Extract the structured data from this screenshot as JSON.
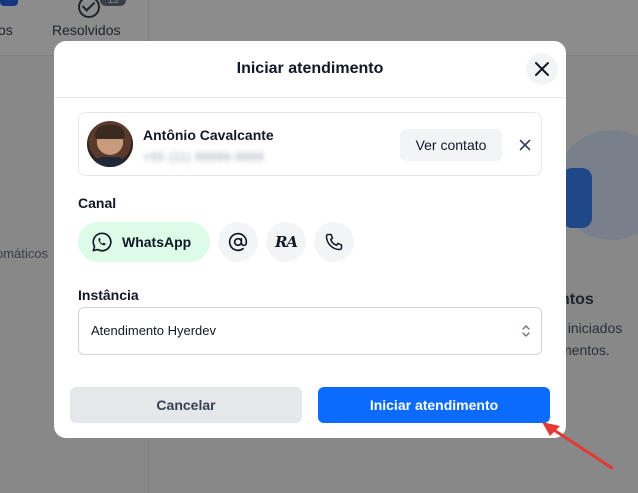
{
  "background": {
    "tabs": [
      "os",
      "Resolvidos"
    ],
    "resolved_badge": "13",
    "left_text": "omáticos",
    "right_title": "ntos",
    "right_line1": ", iniciados",
    "right_line2": "mentos."
  },
  "modal": {
    "title": "Iniciar atendimento",
    "contact": {
      "name": "Antônio Cavalcante",
      "phone": "+55 (11) 99999-9999",
      "view_button": "Ver contato"
    },
    "canal_label": "Canal",
    "channels": [
      {
        "id": "whatsapp",
        "label": "WhatsApp",
        "icon": "whatsapp-icon",
        "selected": true
      },
      {
        "id": "email",
        "icon": "at-sign-icon"
      },
      {
        "id": "reclame-aqui",
        "icon": "ra-icon",
        "text": "RA"
      },
      {
        "id": "phone",
        "icon": "phone-icon"
      }
    ],
    "instance_label": "Instância",
    "instance_value": "Atendimento Hyerdev",
    "cancel_label": "Cancelar",
    "start_label": "Iniciar atendimento"
  },
  "colors": {
    "primary": "#0b6bff",
    "whatsapp_bg": "#dcfce7",
    "annotation_arrow": "#e53935"
  }
}
